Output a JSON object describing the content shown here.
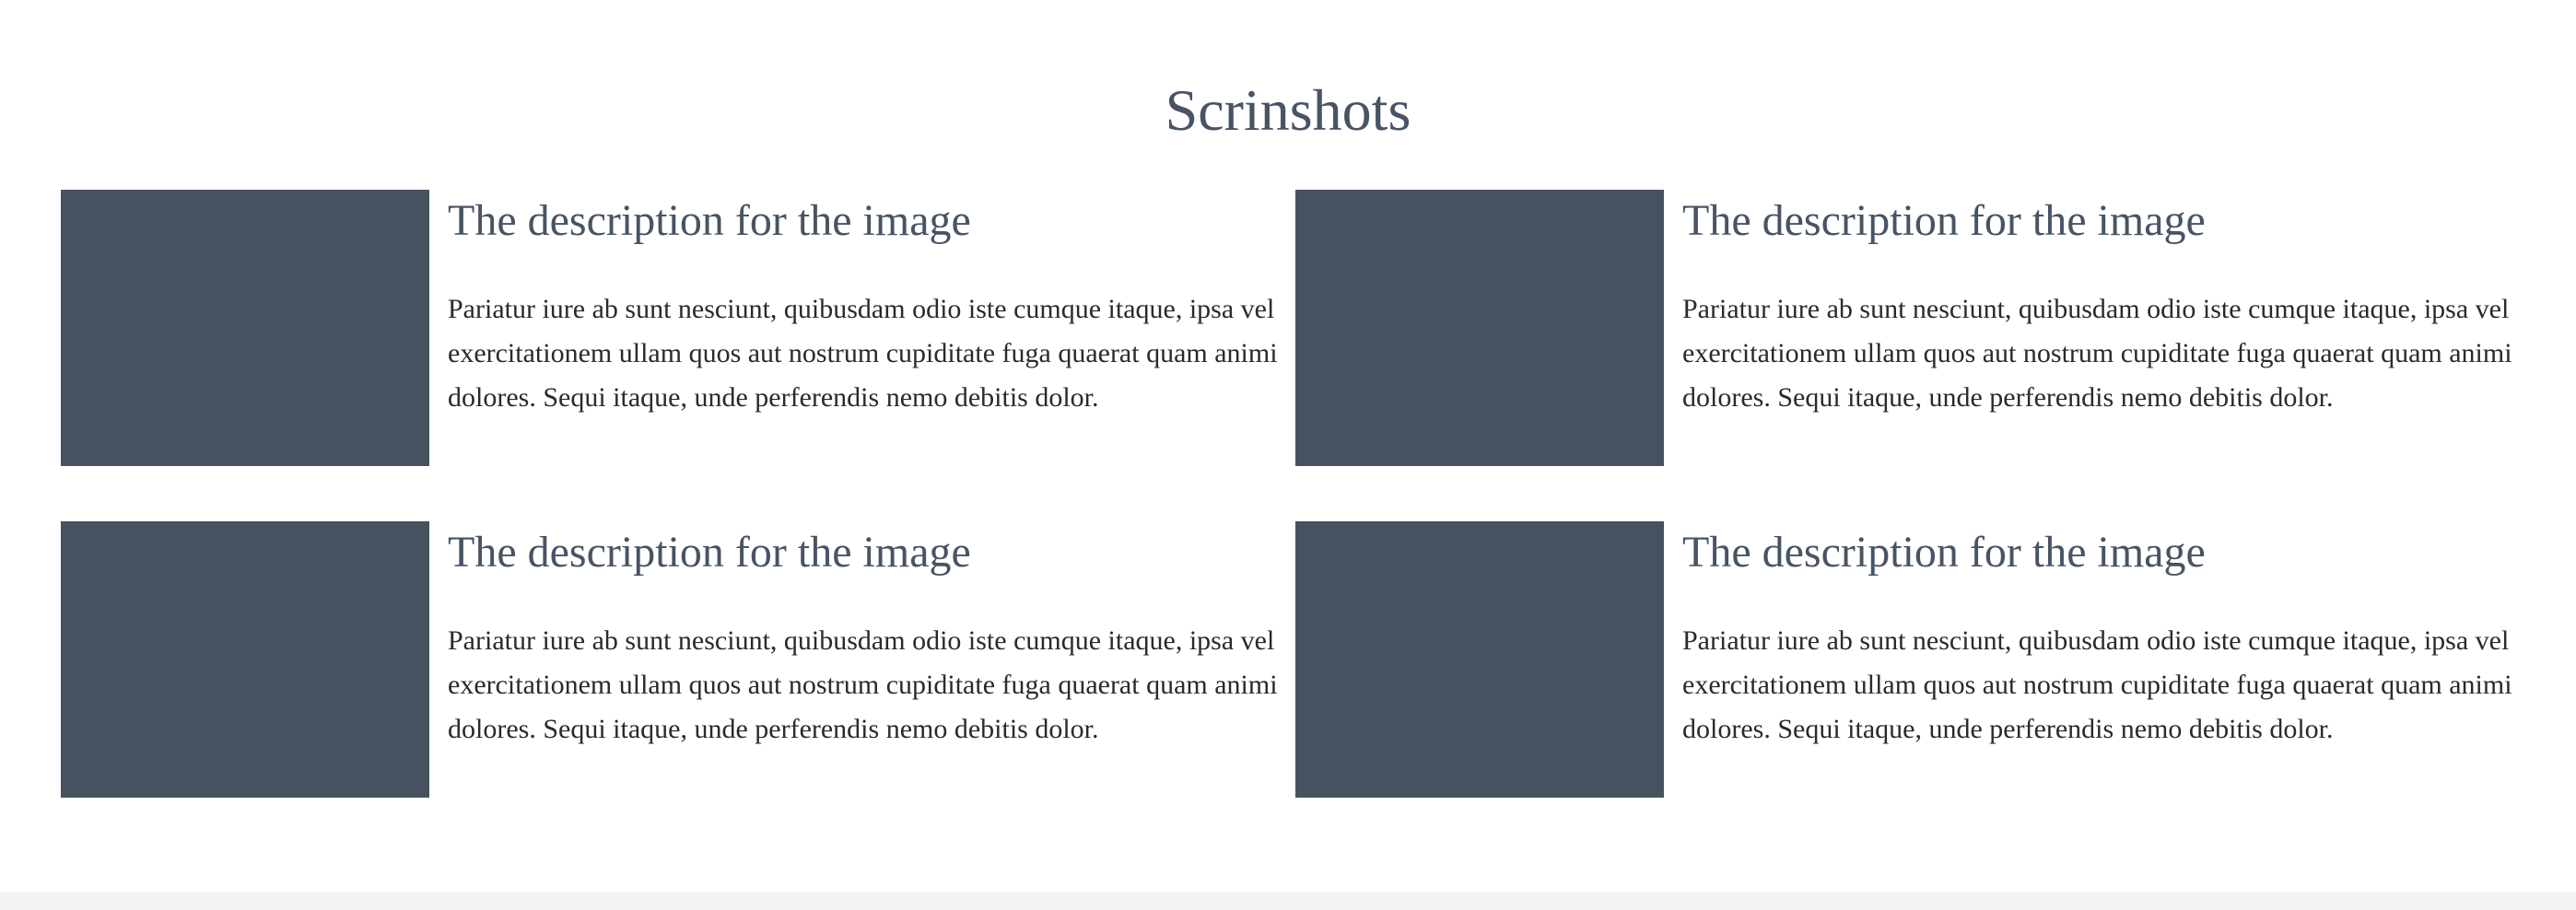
{
  "section": {
    "title": "Scrinshots"
  },
  "cards": [
    {
      "heading": "The description for the image",
      "text": "Pariatur iure ab sunt nesciunt, quibusdam odio iste cumque itaque, ipsa vel exercitationem ullam quos aut nostrum cupiditate fuga quaerat quam animi dolores. Sequi itaque, unde perferendis nemo debitis dolor."
    },
    {
      "heading": "The description for the image",
      "text": "Pariatur iure ab sunt nesciunt, quibusdam odio iste cumque itaque, ipsa vel exercitationem ullam quos aut nostrum cupiditate fuga quaerat quam animi dolores. Sequi itaque, unde perferendis nemo debitis dolor."
    },
    {
      "heading": "The description for the image",
      "text": "Pariatur iure ab sunt nesciunt, quibusdam odio iste cumque itaque, ipsa vel exercitationem ullam quos aut nostrum cupiditate fuga quaerat quam animi dolores. Sequi itaque, unde perferendis nemo debitis dolor."
    },
    {
      "heading": "The description for the image",
      "text": "Pariatur iure ab sunt nesciunt, quibusdam odio iste cumque itaque, ipsa vel exercitationem ullam quos aut nostrum cupiditate fuga quaerat quam animi dolores. Sequi itaque, unde perferendis nemo debitis dolor."
    }
  ],
  "colors": {
    "heading": "#475465",
    "image_placeholder": "#475261",
    "body_text": "#2a2a2a",
    "footer_strip": "#f3f3f3"
  }
}
